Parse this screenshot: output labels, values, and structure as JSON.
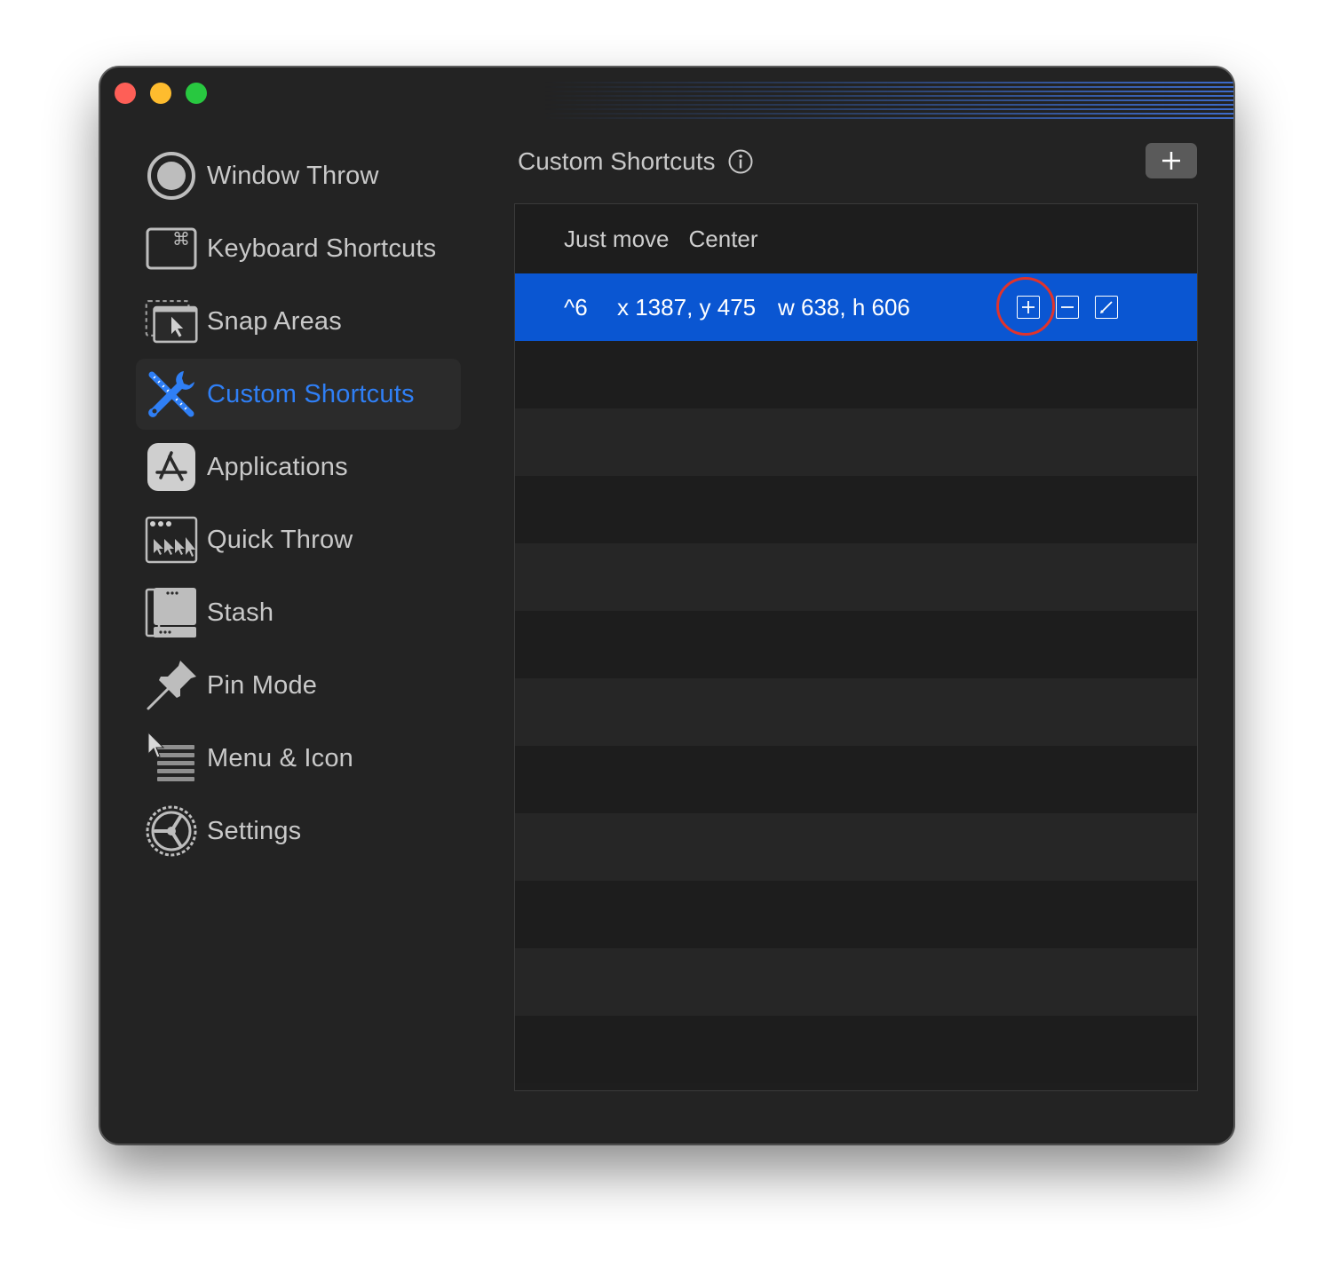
{
  "window": {
    "controls": [
      "close",
      "minimize",
      "maximize"
    ]
  },
  "sidebar": {
    "items": [
      {
        "label": "Window Throw",
        "icon": "window-throw-icon",
        "active": false
      },
      {
        "label": "Keyboard Shortcuts",
        "icon": "keyboard-shortcuts-icon",
        "active": false
      },
      {
        "label": "Snap Areas",
        "icon": "snap-areas-icon",
        "active": false
      },
      {
        "label": "Custom Shortcuts",
        "icon": "custom-shortcuts-icon",
        "active": true
      },
      {
        "label": "Applications",
        "icon": "applications-icon",
        "active": false
      },
      {
        "label": "Quick Throw",
        "icon": "quick-throw-icon",
        "active": false
      },
      {
        "label": "Stash",
        "icon": "stash-icon",
        "active": false
      },
      {
        "label": "Pin Mode",
        "icon": "pin-icon",
        "active": false
      },
      {
        "label": "Menu & Icon",
        "icon": "menu-icon",
        "active": false
      },
      {
        "label": "Settings",
        "icon": "settings-icon",
        "active": false
      }
    ]
  },
  "content": {
    "title": "Custom Shortcuts",
    "add_button": "+",
    "table": {
      "header": {
        "mode": "Just move",
        "position": "Center"
      },
      "rows": [
        {
          "shortcut": "^6",
          "position": "x 1387, y 475",
          "size": "w 638, h 606",
          "selected": true
        }
      ]
    }
  },
  "colors": {
    "accent": "#2f7ff5",
    "selection": "#0a56d2",
    "highlight_ring": "#e0332c",
    "window_bg": "#232323"
  }
}
